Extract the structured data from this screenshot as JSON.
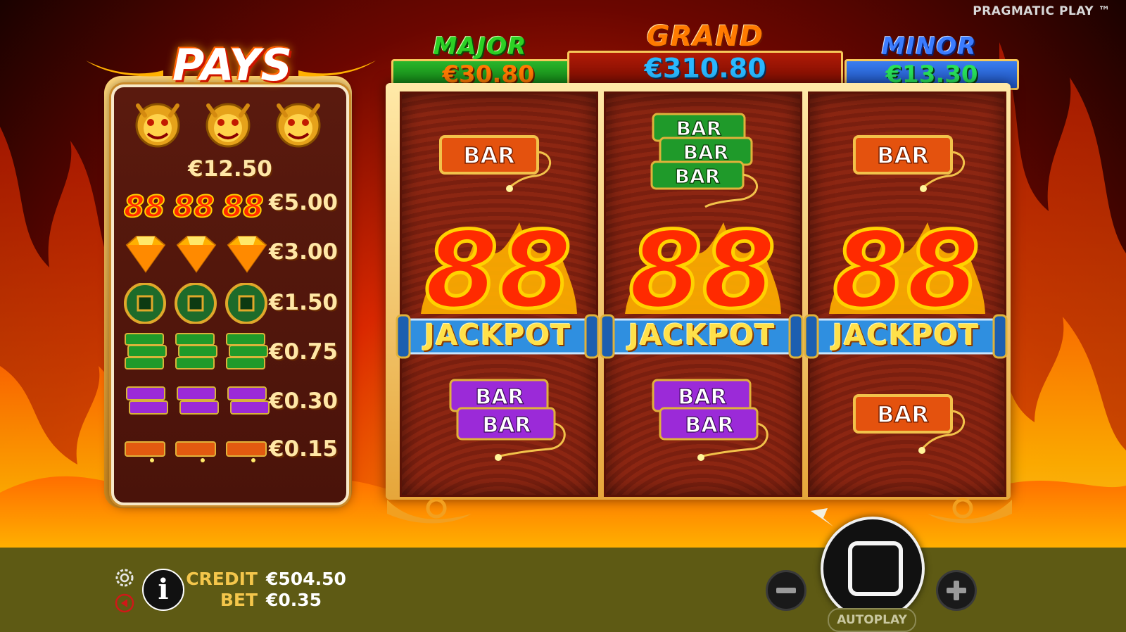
{
  "brand": "PRAGMATIC PLAY ™",
  "paytable": {
    "title": "PAYS",
    "rows": [
      {
        "symbol": "dragon",
        "payout": "€12.50"
      },
      {
        "symbol": "88",
        "payout": "€5.00"
      },
      {
        "symbol": "diamond",
        "payout": "€3.00"
      },
      {
        "symbol": "coin",
        "payout": "€1.50"
      },
      {
        "symbol": "green-triple-bar",
        "payout": "€0.75"
      },
      {
        "symbol": "purple-double-bar",
        "payout": "€0.30"
      },
      {
        "symbol": "orange-bar",
        "payout": "€0.15"
      }
    ]
  },
  "jackpots": {
    "major": {
      "label": "MAJOR",
      "value": "€30.80"
    },
    "grand": {
      "label": "GRAND",
      "value": "€310.80"
    },
    "minor": {
      "label": "MINOR",
      "value": "€13.30"
    }
  },
  "reels": [
    {
      "top": "orange-bar",
      "middle": "88",
      "bottom": "purple-double-bar"
    },
    {
      "top": "green-triple-bar",
      "middle": "88",
      "bottom": "purple-double-bar"
    },
    {
      "top": "orange-bar",
      "middle": "88",
      "bottom": "orange-bar"
    }
  ],
  "symbol_text": {
    "bar": "BAR",
    "eighty_eight": "88",
    "jackpot": "JACKPOT"
  },
  "footer": {
    "credit_label": "CREDIT",
    "credit_value": "€504.50",
    "bet_label": "BET",
    "bet_value": "€0.35",
    "autoplay_label": "AUTOPLAY",
    "info_label": "i"
  },
  "colors": {
    "major": "#22c21e",
    "grand": "#ff7a00",
    "minor": "#3b7cff",
    "jackpot_value": "#ff7a00",
    "grand_value": "#26b6ff",
    "minor_value": "#27e05a"
  }
}
